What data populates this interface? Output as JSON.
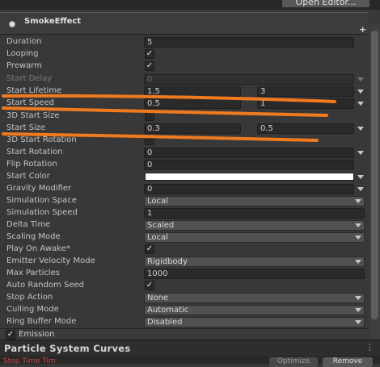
{
  "header": {
    "open_editor_label": "Open Editor..."
  },
  "module": {
    "title": "SmokeEffect",
    "add_symbol": "+"
  },
  "rows": {
    "duration": {
      "label": "Duration",
      "value": "5"
    },
    "looping": {
      "label": "Looping",
      "checked": true
    },
    "prewarm": {
      "label": "Prewarm",
      "checked": true
    },
    "start_delay": {
      "label": "Start Delay",
      "value": "0"
    },
    "start_lifetime": {
      "label": "Start Lifetime",
      "min": "1.5",
      "max": "3"
    },
    "start_speed": {
      "label": "Start Speed",
      "min": "0.5",
      "max": "1"
    },
    "start_size_3d": {
      "label": "3D Start Size",
      "checked": false
    },
    "start_size": {
      "label": "Start Size",
      "min": "0.3",
      "max": "0.5"
    },
    "start_rotation_3d": {
      "label": "3D Start Rotation",
      "checked": false
    },
    "start_rotation": {
      "label": "Start Rotation",
      "value": "0"
    },
    "flip_rotation": {
      "label": "Flip Rotation",
      "value": "0"
    },
    "start_color": {
      "label": "Start Color",
      "color": "#ffffff"
    },
    "gravity_modifier": {
      "label": "Gravity Modifier",
      "value": "0"
    },
    "simulation_space": {
      "label": "Simulation Space",
      "value": "Local"
    },
    "simulation_speed": {
      "label": "Simulation Speed",
      "value": "1"
    },
    "delta_time": {
      "label": "Delta Time",
      "value": "Scaled"
    },
    "scaling_mode": {
      "label": "Scaling Mode",
      "value": "Local"
    },
    "play_on_awake": {
      "label": "Play On Awake*",
      "checked": true
    },
    "emitter_velocity_mode": {
      "label": "Emitter Velocity Mode",
      "value": "Rigidbody"
    },
    "max_particles": {
      "label": "Max Particles",
      "value": "1000"
    },
    "auto_random_seed": {
      "label": "Auto Random Seed",
      "checked": true
    },
    "stop_action": {
      "label": "Stop Action",
      "value": "None"
    },
    "culling_mode": {
      "label": "Culling Mode",
      "value": "Automatic"
    },
    "ring_buffer_mode": {
      "label": "Ring Buffer Mode",
      "value": "Disabled"
    }
  },
  "emission": {
    "label": "Emission",
    "checked": true
  },
  "curves": {
    "title": "Particle System Curves",
    "menu": "⋮"
  },
  "footer": {
    "status_text": "Stop Time Tim",
    "optimize_label": "Optimize",
    "remove_label": "Remove"
  },
  "colors": {
    "annotation_stroke": "#f07a1e",
    "panel_bg": "#383838",
    "field_bg": "#2a2a2a",
    "dropdown_bg": "#515151"
  }
}
